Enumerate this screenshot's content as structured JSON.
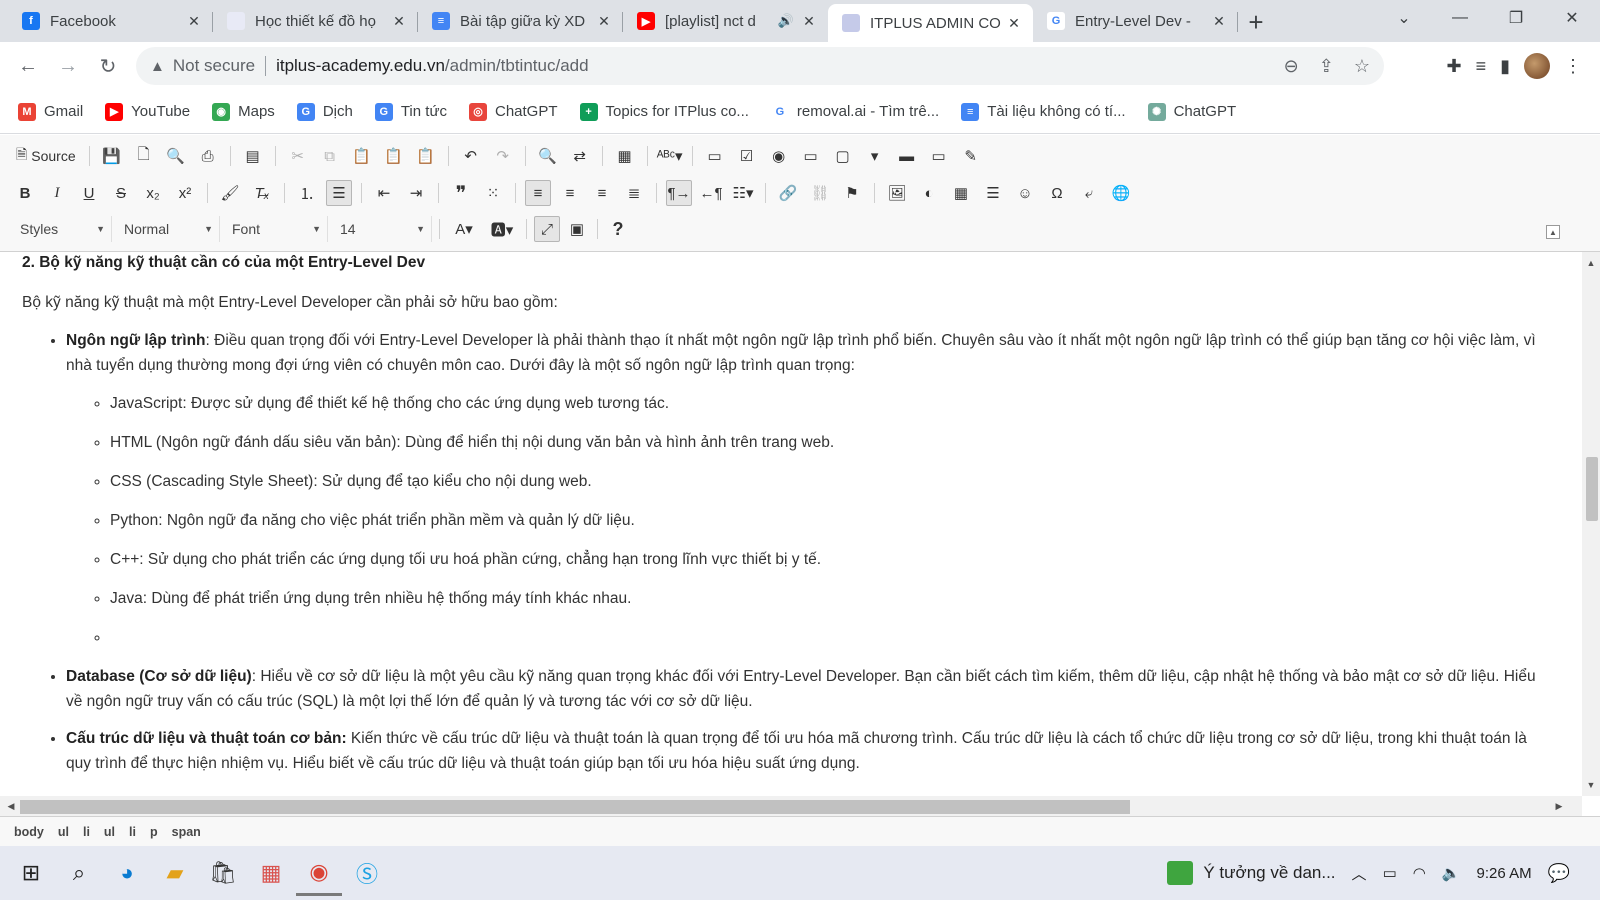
{
  "tabs": [
    {
      "title": "Facebook",
      "icon": "facebook-icon",
      "color": "#1877f2",
      "glyph": "f"
    },
    {
      "title": "Học thiết kế đồ họ",
      "icon": "itplus-icon",
      "color": "#e8eaf6",
      "glyph": ""
    },
    {
      "title": "Bài tập giữa kỳ XD",
      "icon": "docs-icon",
      "color": "#4285f4",
      "glyph": "≡"
    },
    {
      "title": "[playlist] nct d",
      "icon": "youtube-icon",
      "color": "#ff0000",
      "glyph": "▶",
      "speaker": "🔊"
    },
    {
      "title": "ITPLUS ADMIN CO",
      "icon": "itplus-icon",
      "color": "#c5cae9",
      "glyph": ""
    },
    {
      "title": "Entry-Level Dev - ",
      "icon": "google-icon",
      "color": "#ffffff",
      "glyph": "G"
    }
  ],
  "address": {
    "security": "Not secure",
    "host": "itplus-academy.edu.vn",
    "path": "/admin/tbtintuc/add"
  },
  "bookmarks": [
    {
      "label": "Gmail",
      "icon": "gmail-icon",
      "color": "#ea4335",
      "glyph": "M"
    },
    {
      "label": "YouTube",
      "icon": "youtube-icon",
      "color": "#ff0000",
      "glyph": "▶"
    },
    {
      "label": "Maps",
      "icon": "maps-icon",
      "color": "#34a853",
      "glyph": "◉"
    },
    {
      "label": "Dịch",
      "icon": "translate-icon",
      "color": "#4285f4",
      "glyph": "G"
    },
    {
      "label": "Tin tức",
      "icon": "news-icon",
      "color": "#4285f4",
      "glyph": "G"
    },
    {
      "label": "ChatGPT",
      "icon": "chatgpt-icon",
      "color": "#e8453c",
      "glyph": "◎"
    },
    {
      "label": "Topics for ITPlus co...",
      "icon": "sheets-icon",
      "color": "#0f9d58",
      "glyph": "+"
    },
    {
      "label": "removal.ai - Tìm trê...",
      "icon": "google-icon",
      "color": "#ffffff",
      "glyph": "G"
    },
    {
      "label": "Tài liệu không có tí...",
      "icon": "docs-icon",
      "color": "#4285f4",
      "glyph": "≡"
    },
    {
      "label": "ChatGPT",
      "icon": "chatgpt-icon",
      "color": "#74aa9c",
      "glyph": "✺"
    }
  ],
  "toolbar": {
    "source_label": "Source",
    "styles_label": "Styles",
    "format_label": "Normal",
    "font_label": "Font",
    "size_label": "14"
  },
  "content": {
    "heading": "2. Bộ kỹ năng kỹ thuật cần có của một Entry-Level Dev",
    "intro": "Bộ kỹ năng kỹ thuật mà một Entry-Level Developer cần phải sở hữu bao gồm:",
    "item1_bold": "Ngôn ngữ lập trình",
    "item1_text": ": Điều quan trọng đối với Entry-Level Developer là phải thành thạo ít nhất một ngôn ngữ lập trình phổ biến. Chuyên sâu vào ít nhất một ngôn ngữ lập trình có thể giúp bạn tăng cơ hội việc làm, vì nhà tuyển dụng thường mong đợi ứng viên có chuyên môn cao. Dưới đây là một số ngôn ngữ lập trình quan trọng:",
    "languages": [
      "JavaScript: Được sử dụng để thiết kế hệ thống cho các ứng dụng web tương tác.",
      "HTML (Ngôn ngữ đánh dấu siêu văn bản): Dùng để hiển thị nội dung văn bản và hình ảnh trên trang web.",
      "CSS (Cascading Style Sheet): Sử dụng để tạo kiểu cho nội dung web.",
      "Python: Ngôn ngữ đa năng cho việc phát triển phần mềm và quản lý dữ liệu.",
      "C++: Sử dụng cho phát triển các ứng dụng tối ưu hoá phần cứng, chẳng hạn trong lĩnh vực thiết bị y tế.",
      "Java: Dùng để phát triển ứng dụng trên nhiều hệ thống máy tính khác nhau."
    ],
    "item2_bold": "Database (Cơ sở dữ liệu)",
    "item2_text": ": Hiểu về cơ sở dữ liệu là một yêu cầu kỹ năng quan trọng khác đối với Entry-Level Developer. Bạn cần biết cách tìm kiếm, thêm dữ liệu, cập nhật hệ thống và bảo mật cơ sở dữ liệu. Hiểu về ngôn ngữ truy vấn có cấu trúc (SQL) là một lợi thế lớn để quản lý và tương tác với cơ sở dữ liệu.",
    "item3_bold": "Cấu trúc dữ liệu và thuật toán cơ bản:",
    "item3_text": " Kiến thức về cấu trúc dữ liệu và thuật toán là quan trọng để tối ưu hóa mã chương trình. Cấu trúc dữ liệu là cách tổ chức dữ liệu trong cơ sở dữ liệu, trong khi thuật toán là quy trình để thực hiện nhiệm vụ. Hiểu biết về cấu trúc dữ liệu và thuật toán giúp bạn tối ưu hóa hiệu suất ứng dụng."
  },
  "pathbar": [
    "body",
    "ul",
    "li",
    "ul",
    "li",
    "p",
    "span"
  ],
  "taskbar": {
    "notification": "Ý tưởng về dan...",
    "time": "9:26 AM"
  }
}
